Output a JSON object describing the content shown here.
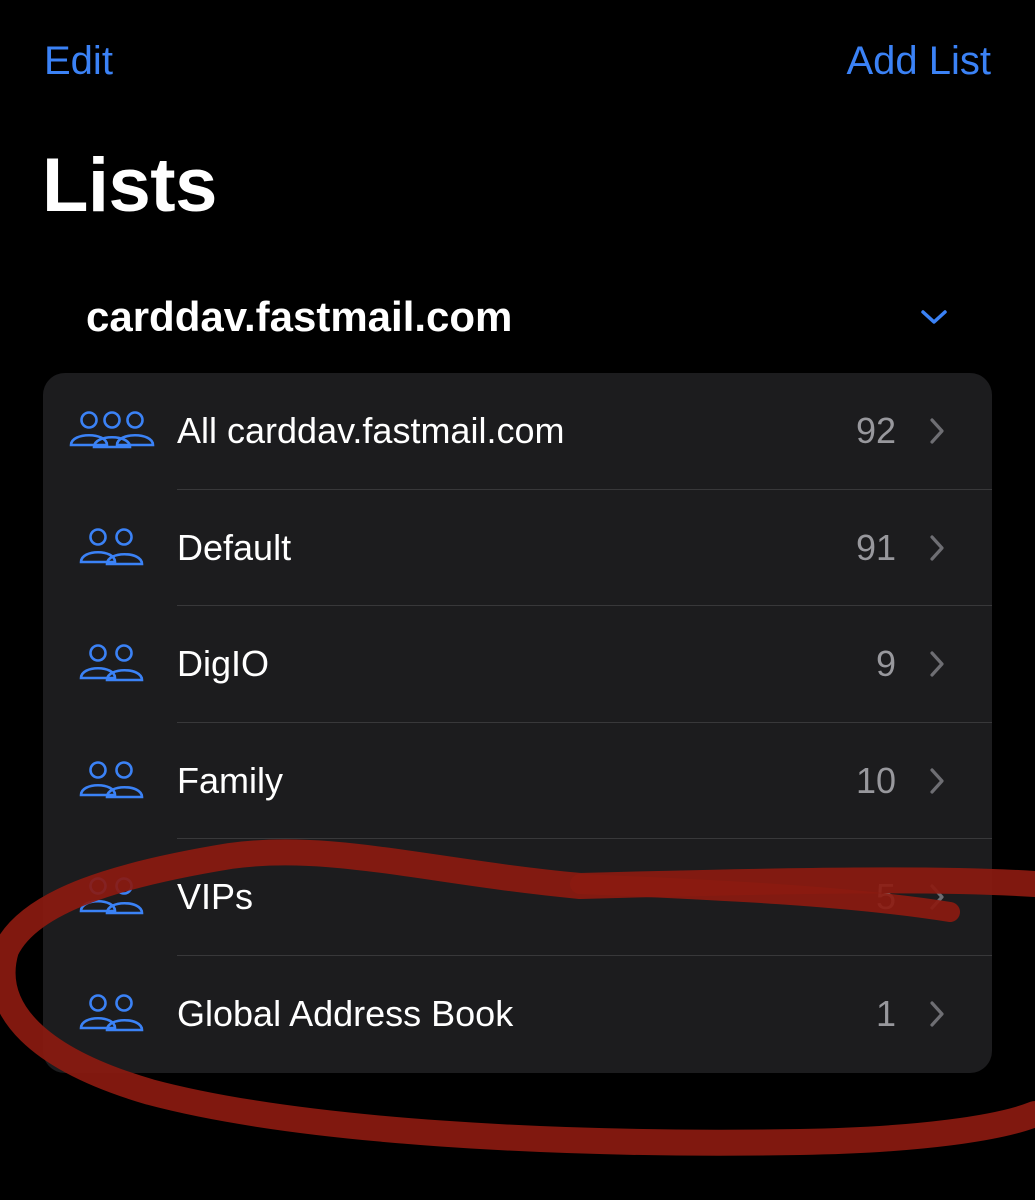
{
  "nav": {
    "edit_label": "Edit",
    "add_list_label": "Add List"
  },
  "page_title": "Lists",
  "section": {
    "title": "carddav.fastmail.com",
    "chevron_icon": "chevron-down-icon"
  },
  "lists": [
    {
      "label": "All carddav.fastmail.com",
      "count": "92",
      "icon": "three-people-icon"
    },
    {
      "label": "Default",
      "count": "91",
      "icon": "two-people-icon"
    },
    {
      "label": "DigIO",
      "count": "9",
      "icon": "two-people-icon"
    },
    {
      "label": "Family",
      "count": "10",
      "icon": "two-people-icon"
    },
    {
      "label": "VIPs",
      "count": "5",
      "icon": "two-people-icon"
    },
    {
      "label": "Global Address Book",
      "count": "1",
      "icon": "two-people-icon"
    }
  ],
  "colors": {
    "background": "#000000",
    "accent": "#3b82f6",
    "card": "#1c1c1e",
    "secondary_text": "#98989d",
    "annotation_red": "#8b1a10"
  }
}
